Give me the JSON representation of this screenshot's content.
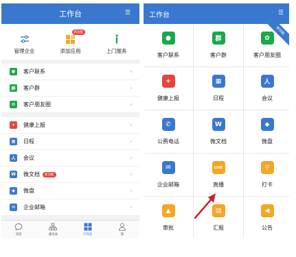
{
  "left": {
    "header_title": "工作台",
    "menu_icon": "menu-icon",
    "quick_actions": [
      {
        "label": "管理企业",
        "icon": "sliders-icon",
        "color": "#3a78cf"
      },
      {
        "label": "添加应用",
        "icon": "apps-add-icon",
        "color": "#f5a623",
        "badge": "新功能"
      },
      {
        "label": "上门服务",
        "icon": "service-icon",
        "color": "#1aa84a"
      }
    ],
    "group1": [
      {
        "label": "客户联系",
        "color": "#1aa84a",
        "glyph": "●"
      },
      {
        "label": "客户群",
        "color": "#1aa84a",
        "glyph": "群"
      },
      {
        "label": "客户朋友圈",
        "color": "#1aa84a",
        "glyph": "✿"
      }
    ],
    "group2": [
      {
        "label": "健康上报",
        "color": "#e5453b",
        "glyph": "+"
      },
      {
        "label": "日程",
        "color": "#3a78cf",
        "glyph": "▦"
      },
      {
        "label": "会议",
        "color": "#3a78cf",
        "glyph": "人"
      },
      {
        "label": "微文档",
        "color": "#3a78cf",
        "glyph": "W",
        "badge": "新功能"
      },
      {
        "label": "微盘",
        "color": "#3a78cf",
        "glyph": "◆"
      },
      {
        "label": "企业邮箱",
        "color": "#3a78cf",
        "glyph": "✉"
      }
    ],
    "chevron": "›",
    "tabs": [
      {
        "label": "消息",
        "icon": "chat-icon"
      },
      {
        "label": "通讯录",
        "icon": "contacts-icon"
      },
      {
        "label": "工作台",
        "icon": "workbench-icon",
        "active": true
      },
      {
        "label": "我",
        "icon": "person-icon"
      }
    ]
  },
  "right": {
    "header_title": "工作台",
    "menu_icon": "menu-icon",
    "ribbon": "新功能",
    "grid": [
      {
        "label": "客户联系",
        "color": "#1aa84a",
        "glyph": "●"
      },
      {
        "label": "客户群",
        "color": "#1aa84a",
        "glyph": "群"
      },
      {
        "label": "客户朋友圈",
        "color": "#1aa84a",
        "glyph": "✿"
      },
      {
        "label": "健康上报",
        "color": "#e5453b",
        "glyph": "+"
      },
      {
        "label": "日程",
        "color": "#3a78cf",
        "glyph": "▦"
      },
      {
        "label": "会议",
        "color": "#3a78cf",
        "glyph": "人"
      },
      {
        "label": "公费电话",
        "color": "#3a78cf",
        "glyph": "✆"
      },
      {
        "label": "微文档",
        "color": "#3a78cf",
        "glyph": "W"
      },
      {
        "label": "微盘",
        "color": "#3a78cf",
        "glyph": "◆"
      },
      {
        "label": "企业邮箱",
        "color": "#3a78cf",
        "glyph": "✉"
      },
      {
        "label": "直播",
        "color": "#f5a623",
        "glyph": "LIVE"
      },
      {
        "label": "打卡",
        "color": "#f5a623",
        "glyph": "⚲"
      },
      {
        "label": "审批",
        "color": "#f5a623",
        "glyph": "▲"
      },
      {
        "label": "汇报",
        "color": "#f5a623",
        "glyph": "▤"
      },
      {
        "label": "公告",
        "color": "#f5a623",
        "glyph": "◀"
      }
    ],
    "annotation_color": "#c8232c"
  }
}
